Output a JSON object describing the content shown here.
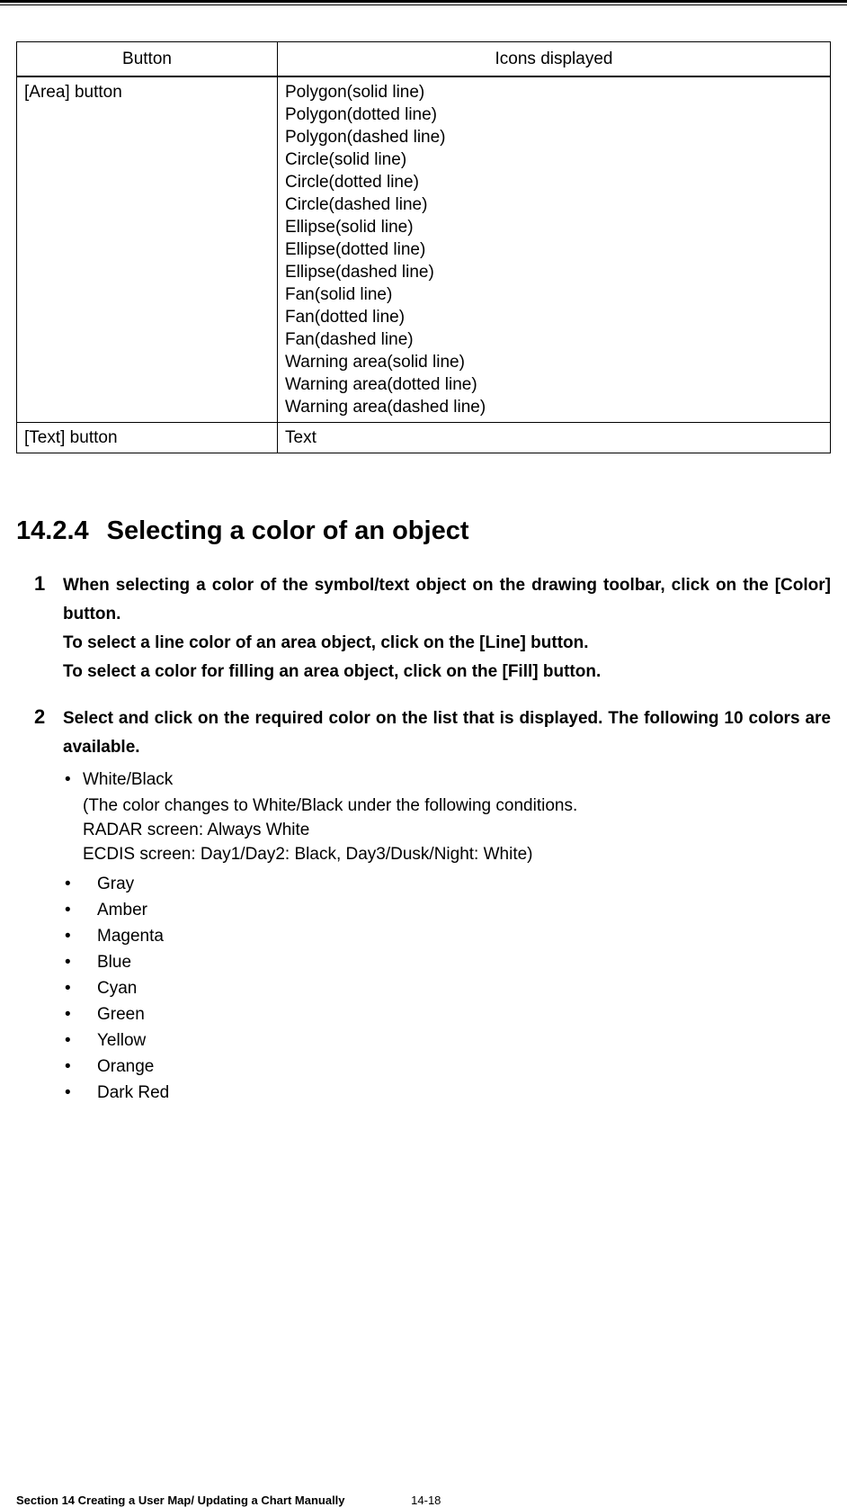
{
  "table": {
    "headers": {
      "button": "Button",
      "icons": "Icons displayed"
    },
    "rows": [
      {
        "button": "[Area] button",
        "icons": [
          "Polygon(solid line)",
          "Polygon(dotted line)",
          "Polygon(dashed line)",
          "Circle(solid line)",
          "Circle(dotted line)",
          "Circle(dashed line)",
          "Ellipse(solid line)",
          "Ellipse(dotted line)",
          "Ellipse(dashed line)",
          "Fan(solid line)",
          "Fan(dotted line)",
          "Fan(dashed line)",
          "Warning area(solid line)",
          "Warning area(dotted line)",
          "Warning area(dashed line)"
        ]
      },
      {
        "button": "[Text] button",
        "icons": [
          "Text"
        ]
      }
    ]
  },
  "section": {
    "number": "14.2.4",
    "title": "Selecting a color of an object"
  },
  "steps": [
    {
      "num": "1",
      "bold_lines": [
        "When selecting a color of the symbol/text object on the drawing toolbar, click on the [Color] button.",
        "To select a line color of an area object, click on the [Line] button.",
        "To select a color for filling an area object, click on the [Fill] button."
      ],
      "items": []
    },
    {
      "num": "2",
      "bold_lines": [
        "Select and click on the required color on the list that is displayed. The following 10 colors are available."
      ],
      "first_item": {
        "label": "White/Black",
        "notes": [
          "(The color changes to White/Black under the following conditions.",
          "RADAR screen: Always White",
          "ECDIS screen: Day1/Day2: Black, Day3/Dusk/Night: White)"
        ]
      },
      "items": [
        "Gray",
        "Amber",
        "Magenta",
        "Blue",
        "Cyan",
        "Green",
        "Yellow",
        "Orange",
        "Dark Red"
      ]
    }
  ],
  "footer": {
    "section": "Section 14    Creating a User Map/ Updating a Chart Manually",
    "page": "14-18"
  }
}
